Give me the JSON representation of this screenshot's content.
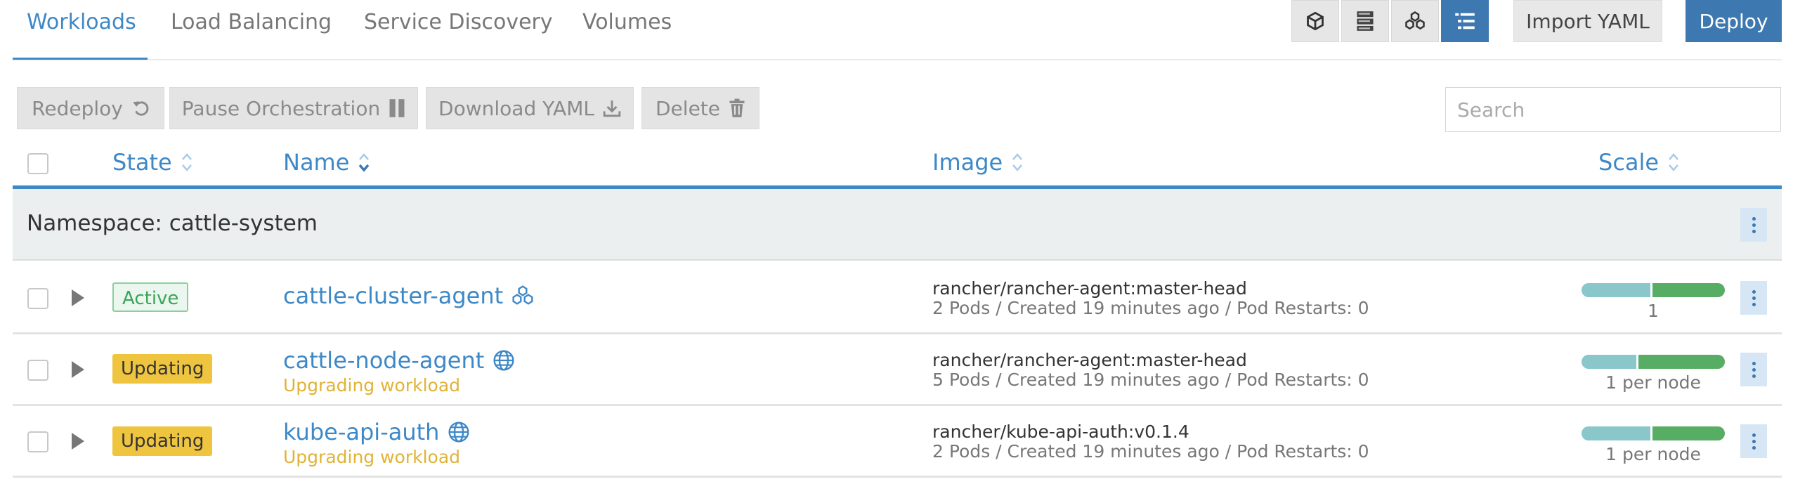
{
  "tabs": [
    "Workloads",
    "Load Balancing",
    "Service Discovery",
    "Volumes"
  ],
  "view_buttons": [
    "cube-icon",
    "server-icon",
    "cluster-icon",
    "list-icon"
  ],
  "header": {
    "import_label": "Import YAML",
    "deploy_label": "Deploy"
  },
  "actions": {
    "redeploy": "Redeploy",
    "pause": "Pause Orchestration",
    "download": "Download YAML",
    "delete": "Delete"
  },
  "search": {
    "placeholder": "Search",
    "value": ""
  },
  "columns": {
    "state": "State",
    "name": "Name",
    "image": "Image",
    "scale": "Scale"
  },
  "namespace": {
    "label": "Namespace: cattle-system"
  },
  "rows": [
    {
      "state": "Active",
      "name": "cattle-cluster-agent",
      "name_icon": "cluster-icon",
      "subtitle": "",
      "image": "rancher/rancher-agent:master-head",
      "meta": "2 Pods / Created 19 minutes ago / Pod Restarts: 0",
      "scale": "1"
    },
    {
      "state": "Updating",
      "name": "cattle-node-agent",
      "name_icon": "globe-icon",
      "subtitle": "Upgrading workload",
      "image": "rancher/rancher-agent:master-head",
      "meta": "5 Pods / Created 19 minutes ago / Pod Restarts: 0",
      "scale": "1 per node"
    },
    {
      "state": "Updating",
      "name": "kube-api-auth",
      "name_icon": "globe-icon",
      "subtitle": "Upgrading workload",
      "image": "rancher/kube-api-auth:v0.1.4",
      "meta": "2 Pods / Created 19 minutes ago / Pod Restarts: 0",
      "scale": "1 per node"
    }
  ],
  "colors": {
    "accent": "#3d88c7",
    "primary": "#3d78b0",
    "updating": "#efc53f",
    "active": "#3ba45a",
    "warning_text": "#e0b336"
  }
}
